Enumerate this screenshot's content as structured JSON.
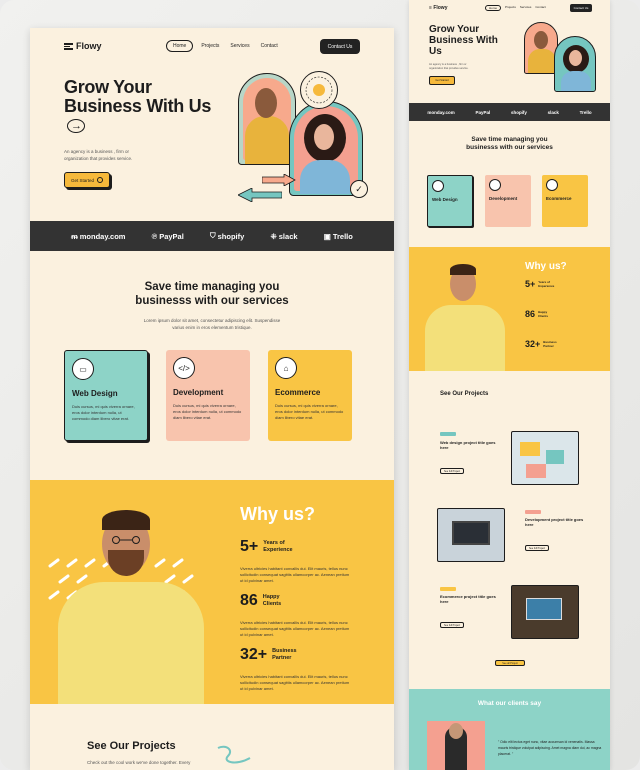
{
  "brand": {
    "name": "Flowy"
  },
  "nav": {
    "items": [
      "Home",
      "Projects",
      "Services",
      "Contact"
    ],
    "contact_button": "Contact Us"
  },
  "hero": {
    "title": "Grow Your Business With Us",
    "subtitle": "An agency is a business , firm or organization that provides service.",
    "cta": "Get Started",
    "badge_text": "Agency · Agency ·"
  },
  "partners": [
    "monday.com",
    "PayPal",
    "shopify",
    "slack",
    "Trello"
  ],
  "services": {
    "title": "Save time managing you businesss with our services",
    "subtitle": "Lorem ipsum dolor sit amet, consectetur adipiscing elit. Suspendisse varius enim in eros elementum tristique.",
    "cards": [
      {
        "title": "Web Design",
        "desc": "Duis cursus, mi quis viverra ornare, eros dolor interdum nulla, ut commodo diam libero vitae erat.",
        "color": "#8dd3c7",
        "icon": "monitor-icon"
      },
      {
        "title": "Development",
        "desc": "Duis cursus, mi quis viverra ornare, eros dolor interdum nulla, ut commodo diam libero vitae erat.",
        "color": "#f8c4ad",
        "icon": "code-window-icon"
      },
      {
        "title": "Ecommerce",
        "desc": "Duis cursus, mi quis viverra ornare, eros dolor interdum nulla, ut commodo diam libero vitae erat.",
        "color": "#f9c544",
        "icon": "shopping-bag-icon"
      }
    ]
  },
  "why": {
    "title": "Why us?",
    "stats": [
      {
        "num": "5+",
        "label1": "Years of",
        "label2": "Experience",
        "desc": "Viverra ultricies habitant convallis dui. Elit mauris, tellus nunc sollicitudin consequat sagittis ullamcorper ac. Aenean pretium ut id pulvinar amet."
      },
      {
        "num": "86",
        "label1": "Happy",
        "label2": "Clients",
        "desc": "Viverra ultricies habitant convallis dui. Elit mauris, tellus nunc sollicitudin consequat sagittis ullamcorper ac. Aenean pretium ut id pulvinar amet."
      },
      {
        "num": "32+",
        "label1": "Business",
        "label2": "Partner",
        "desc": "Viverra ultricies habitant convallis dui. Elit mauris, tellus nunc sollicitudin consequat sagittis ullamcorper ac. Aenean pretium ut id pulvinar amet."
      }
    ]
  },
  "projects": {
    "title": "See Our Projects",
    "subtitle": "Check out the cool work we've done together. Every",
    "items": [
      {
        "title": "Web design project title goes here",
        "link": "See full Project"
      },
      {
        "title": "Development project title goes here",
        "link": "See full Project"
      },
      {
        "title": "Ecommerce project title goes here",
        "link": "See full Project"
      }
    ],
    "more": "See all Project"
  },
  "clients": {
    "title": "What our clients say",
    "quote": "\" Odio elit lectus eget nunc, vitae accumsan id venenatis. Massa mauris tristique volutpat adipiscing. Amet magna diam dui, ac magna placerat. \""
  },
  "colors": {
    "cream": "#fbf1df",
    "yellow": "#f9c544",
    "teal": "#8dd3c7",
    "peach": "#f8c4ad",
    "dark": "#333333"
  }
}
